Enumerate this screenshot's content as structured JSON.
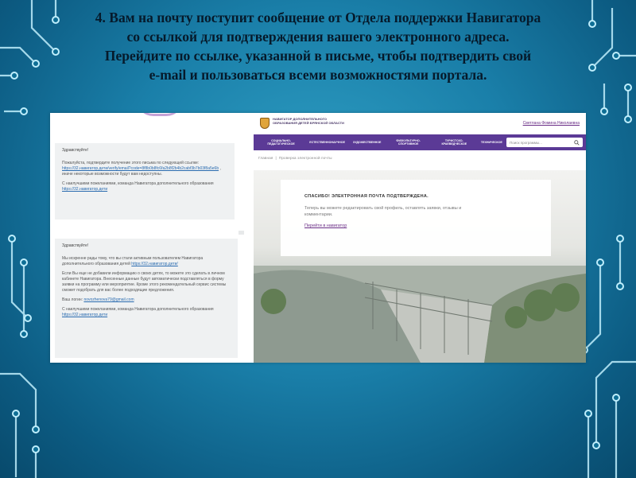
{
  "slide": {
    "heading": [
      "4. Вам на почту поступит сообщение от Отдела поддержки Навигатора",
      "со ссылкой для подтверждения вашего электронного адреса.",
      "Перейдите по ссылке, указанной в письме, чтобы подтвердить свой",
      "e-mail и пользоваться всеми возможностями портала."
    ]
  },
  "email1": {
    "greeting": "Здравствуйте!",
    "text": "Пожалуйста, подтвердите получение этого письма по следующей ссылке:",
    "link": "https://32.навигатор.дети/verify/email?code=8f8b0b8fc6fa2b8f2b4b2cabf3b7b03f8a5e6b",
    "text_after_link": ", иначе некоторые возможности будут вам недоступны.",
    "sign_prefix": "С наилучшими пожеланиями, команда Навигатора дополнительного образования",
    "sign_link": "https://32.навигатор.дети"
  },
  "email2": {
    "greeting": "Здравствуйте!",
    "p1": "Мы искренне рады тому, что вы стали активным пользователем Навигатора дополнительного образования детей",
    "p1_link": "https://32.навигатор.дети/",
    "p2": "Если Вы еще не добавили информацию о своих детях, то можете это сделать в личном кабинете Навигатора. Внесенные данные будут автоматически подставляться в форму заявки на программу или мероприятие. Кроме этого рекомендательный сервис системы сможет подобрать для вас более подходящие предложения.",
    "login_label": "Ваш логин:",
    "login_value": "novozhenova79@gmail.com",
    "sign_prefix": "С наилучшими пожеланиями, команда Навигатора дополнительного образования",
    "sign_link": "https://32.навигатор.дети"
  },
  "portal": {
    "logo_text": "НАВИГАТОР ДОПОЛНИТЕЛЬНОГО ОБРАЗОВАНИЯ ДЕТЕЙ БРЯНСКОЙ ОБЛАСТИ",
    "user_name": "Светлана Фомина Николаевна",
    "nav": [
      "СОЦИАЛЬНО-ПЕДАГОГИЧЕСКОЕ",
      "ЕСТЕСТВЕННОНАУЧНОЕ",
      "ХУДОЖЕСТВЕННОЕ",
      "ФИЗКУЛЬТУРНО-СПОРТИВНОЕ",
      "ТУРИСТСКО-КРАЕВЕДЧЕСКОЕ",
      "ТЕХНИЧЕСКОЕ"
    ],
    "search_placeholder": "Поиск программы...",
    "breadcrumb": [
      "Главная",
      "Проверка электронной почты"
    ],
    "card_title": "СПАСИБО! ЭЛЕКТРОННАЯ ПОЧТА ПОДТВЕРЖДЕНА.",
    "card_text": "Теперь вы можете редактировать свой профиль, оставлять заявки, отзывы и комментарии.",
    "card_link": "Перейти в навигатор"
  }
}
